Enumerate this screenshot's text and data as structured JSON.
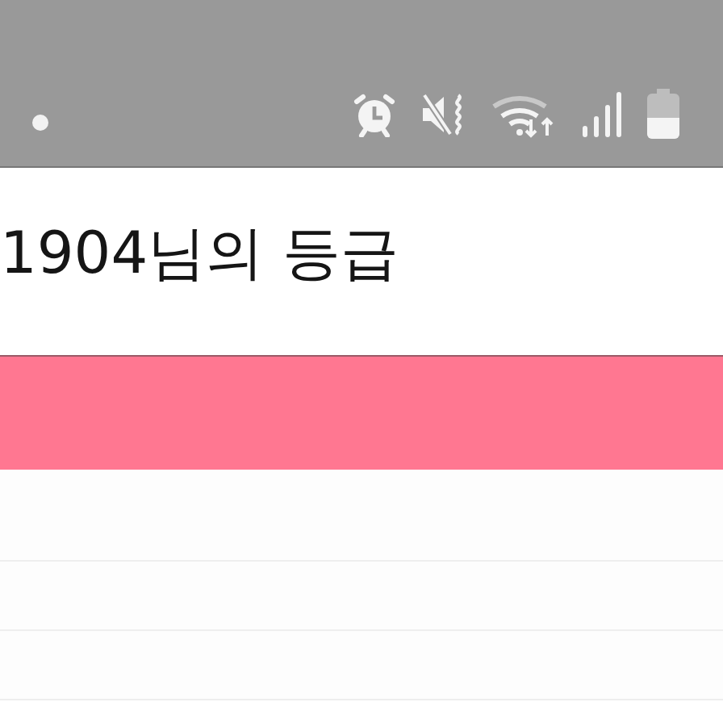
{
  "header": {
    "title": "1904님의 등급"
  }
}
